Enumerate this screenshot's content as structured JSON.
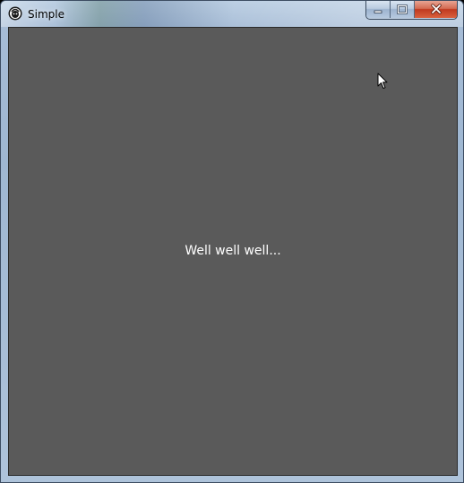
{
  "window": {
    "title": "Simple",
    "app_icon": "app-logo-icon",
    "controls": {
      "minimize_icon": "minimize-icon",
      "maximize_icon": "maximize-icon",
      "close_icon": "close-icon"
    }
  },
  "content": {
    "message": "Well well well...",
    "background_color": "#5a5a5a",
    "text_color": "#ffffff"
  },
  "cursor_icon": "arrow-cursor-icon"
}
